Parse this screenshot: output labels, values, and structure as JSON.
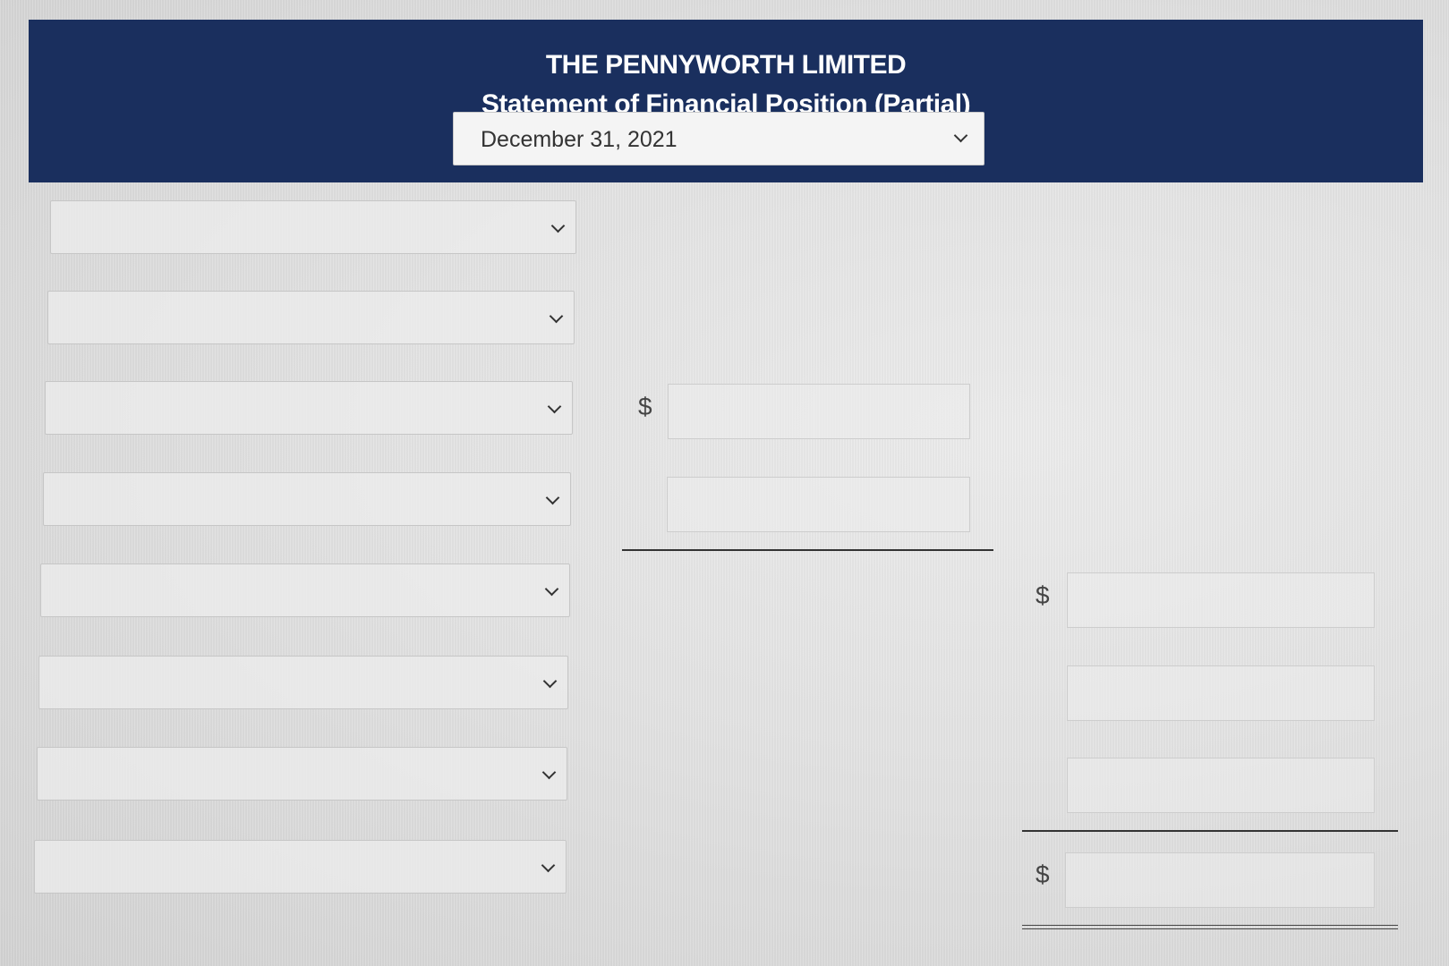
{
  "header": {
    "company": "THE PENNYWORTH LIMITED",
    "statement": "Statement of Financial Position (Partial)",
    "date_select": {
      "value": "December 31, 2021",
      "icon": "chevron-down-icon"
    }
  },
  "account_selects": [
    {
      "value": ""
    },
    {
      "value": ""
    },
    {
      "value": ""
    },
    {
      "value": ""
    },
    {
      "value": ""
    },
    {
      "value": ""
    },
    {
      "value": ""
    },
    {
      "value": ""
    }
  ],
  "column1": {
    "currency_symbol": "$",
    "inputs": [
      {
        "value": ""
      },
      {
        "value": ""
      }
    ]
  },
  "column2": {
    "currency_symbol": "$",
    "inputs": [
      {
        "value": ""
      },
      {
        "value": ""
      },
      {
        "value": ""
      }
    ],
    "total_currency_symbol": "$",
    "total_input": {
      "value": ""
    }
  },
  "colors": {
    "header_bg": "#1a2f5e",
    "header_text": "#ffffff"
  }
}
